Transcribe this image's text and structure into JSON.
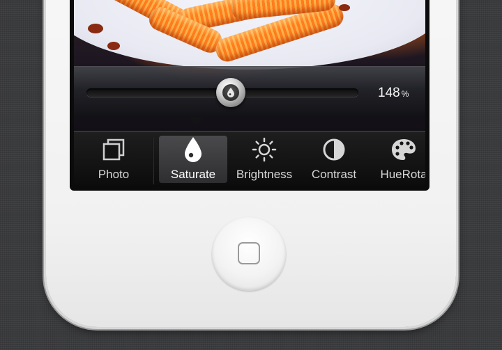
{
  "slider": {
    "value": "148",
    "unit": "%",
    "level": 0.53,
    "knob_icon": "drop-icon"
  },
  "toolbar": {
    "active": "saturate",
    "items": [
      {
        "id": "photo",
        "label": "Photo",
        "icon": "photos-icon"
      },
      {
        "id": "saturate",
        "label": "Saturate",
        "icon": "drop-icon"
      },
      {
        "id": "brightness",
        "label": "Brightness",
        "icon": "sun-icon"
      },
      {
        "id": "contrast",
        "label": "Contrast",
        "icon": "contrast-icon"
      },
      {
        "id": "huerotate",
        "label": "HueRota",
        "icon": "palette-icon"
      }
    ]
  },
  "colors": {
    "device": "#f2f2f2",
    "background": "#3a3b3d",
    "toolbar": "#141415",
    "text": "#d6d6d6"
  }
}
